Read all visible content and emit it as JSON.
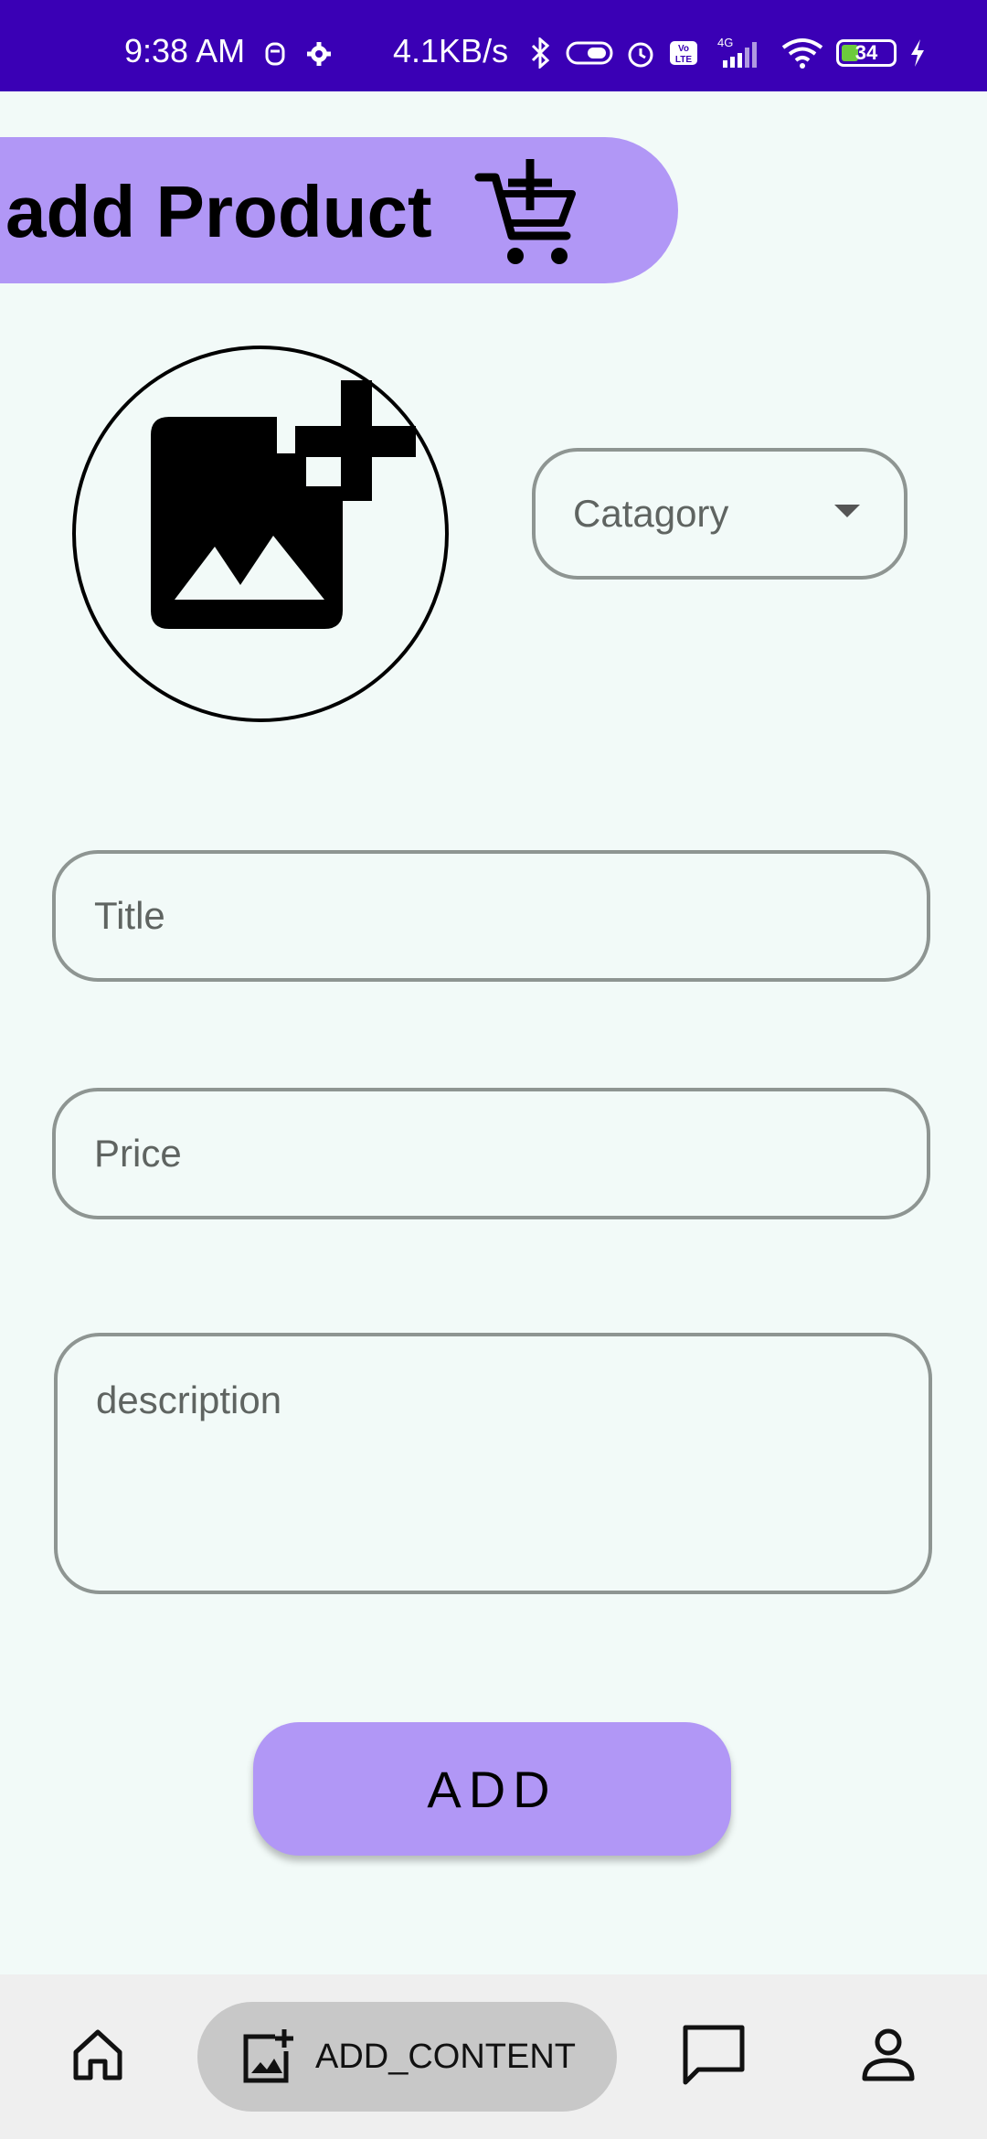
{
  "status_bar": {
    "time": "9:38 AM",
    "speed": "4.1KB/s",
    "battery_level": "34",
    "network": "4G",
    "icons": [
      "face-icon",
      "settings-gear-icon",
      "bluetooth-icon",
      "toggle-icon",
      "alarm-icon",
      "volte-icon",
      "signal-icon",
      "wifi-icon",
      "battery-icon",
      "charging-icon"
    ],
    "bg_color": "#3A00B5"
  },
  "header": {
    "title": "add Product",
    "icon": "add-to-cart-icon",
    "bg_color": "#B197F6"
  },
  "image_picker": {
    "icon": "add-photo-icon"
  },
  "category": {
    "label": "Catagory",
    "icon": "dropdown-caret-icon"
  },
  "form": {
    "title_placeholder": "Title",
    "price_placeholder": "Price",
    "description_placeholder": "description"
  },
  "add_button": {
    "label": "ADD",
    "bg_color": "#B197F6"
  },
  "bottom_nav": {
    "items": [
      {
        "icon": "home-icon",
        "label": ""
      },
      {
        "icon": "add-photo-icon",
        "label": "ADD_CONTENT",
        "selected": true
      },
      {
        "icon": "chat-icon",
        "label": ""
      },
      {
        "icon": "profile-icon",
        "label": ""
      }
    ]
  }
}
